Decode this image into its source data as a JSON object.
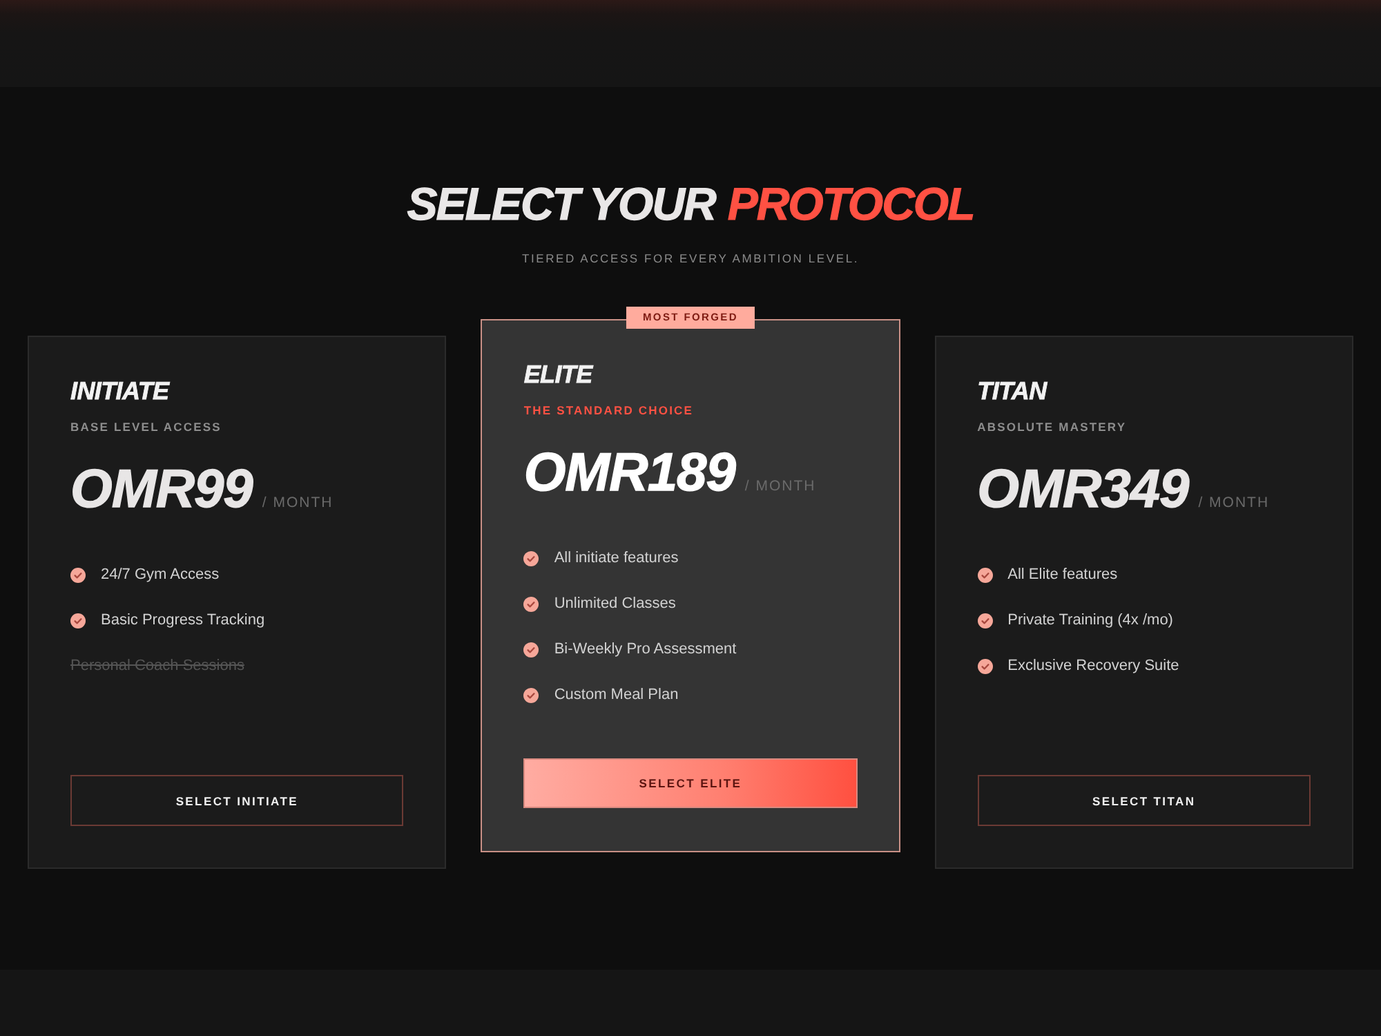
{
  "header": {
    "title": [
      {
        "text": "SELECT YOUR",
        "accent": false
      },
      {
        "text": "PROTOCOL",
        "accent": true
      }
    ],
    "subtitle": "TIERED ACCESS FOR EVERY AMBITION LEVEL."
  },
  "plans": [
    {
      "name": "INITIATE",
      "tagline": "BASE LEVEL ACCESS",
      "price": "OMR99",
      "period": "/ MONTH",
      "featured": false,
      "features": [
        {
          "text": "24/7 Gym Access",
          "included": true
        },
        {
          "text": "Basic Progress Tracking",
          "included": true
        },
        {
          "text": "Personal Coach Sessions",
          "included": false
        }
      ],
      "button": "SELECT INITIATE"
    },
    {
      "badge": "MOST FORGED",
      "name": "ELITE",
      "tagline": "THE STANDARD CHOICE",
      "price": "OMR189",
      "period": "/ MONTH",
      "featured": true,
      "features": [
        {
          "text": "All initiate features",
          "included": true
        },
        {
          "text": "Unlimited Classes",
          "included": true
        },
        {
          "text": "Bi-Weekly Pro Assessment",
          "included": true
        },
        {
          "text": "Custom Meal Plan",
          "included": true
        }
      ],
      "button": "SELECT ELITE"
    },
    {
      "name": "TITAN",
      "tagline": "ABSOLUTE MASTERY",
      "price": "OMR349",
      "period": "/ MONTH",
      "featured": false,
      "features": [
        {
          "text": "All Elite features",
          "included": true
        },
        {
          "text": "Private Training (4x /mo)",
          "included": true
        },
        {
          "text": "Exclusive Recovery Suite",
          "included": true
        }
      ],
      "button": "SELECT TITAN"
    }
  ]
}
